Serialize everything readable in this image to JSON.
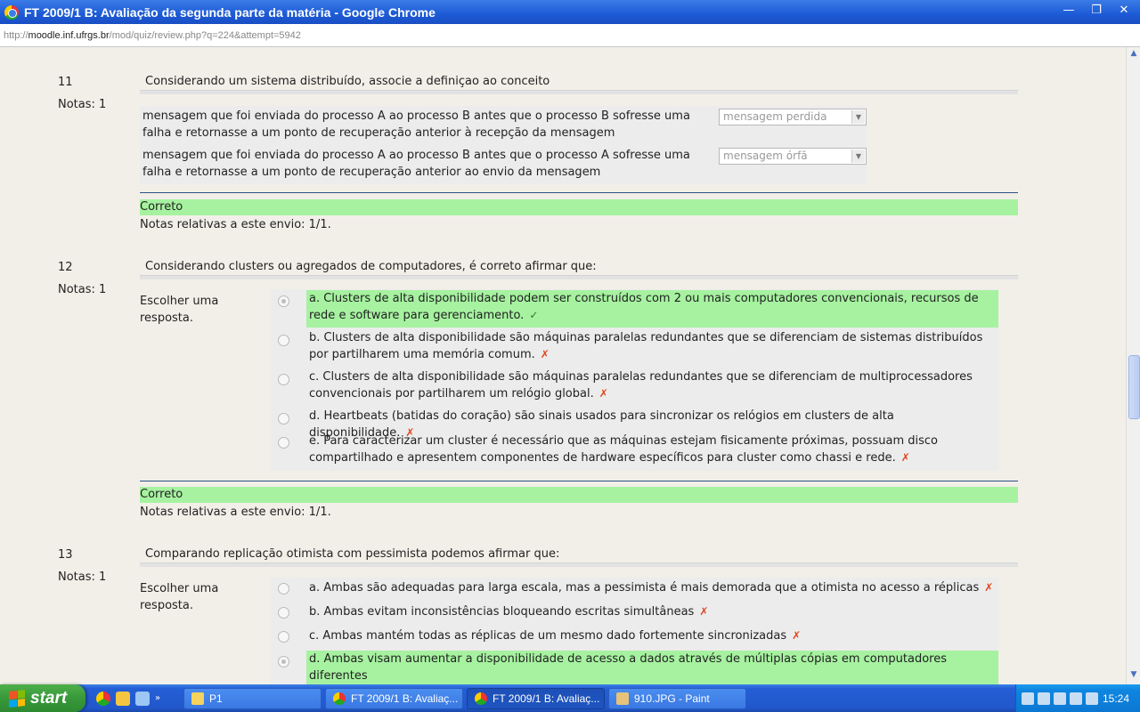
{
  "window": {
    "title": "FT 2009/1 B: Avaliação da segunda parte da matéria - Google Chrome",
    "buttons": {
      "minimize": "—",
      "restore": "❐",
      "close": "✕"
    }
  },
  "address": {
    "prefix": "http://",
    "host": "moodle.inf.ufrgs.br",
    "path": "/mod/quiz/review.php?q=224&attempt=5942"
  },
  "colors": {
    "correct_bg": "#a6f2a0",
    "wrong_mark": "#e0431c",
    "titlebar": "#1c5ad6"
  },
  "q11": {
    "number": "11",
    "grade": "Notas: 1",
    "text": "Considerando um sistema distribuído, associe a definiçao ao conceito",
    "rows": [
      {
        "text": "mensagem que foi enviada do processo A ao processo B antes que o processo B sofresse uma falha e retornasse a um ponto de recuperação anterior à recepção da mensagem",
        "selected": "mensagem perdida"
      },
      {
        "text": "mensagem que foi enviada do processo A ao processo B antes que o processo A sofresse uma falha e retornasse a um ponto de recuperação anterior ao envio da mensagem",
        "selected": "mensagem órfã"
      }
    ],
    "result": "Correto",
    "notes": "Notas relativas a este envio: 1/1."
  },
  "q12": {
    "number": "12",
    "grade": "Notas: 1",
    "text": "Considerando clusters ou agregados de computadores, é correto afirmar que:",
    "choose": "Escolher uma resposta.",
    "options": [
      {
        "text": "a. Clusters de alta disponibilidade podem ser construídos com 2 ou mais computadores convencionais, recursos de rede e software para gerenciamento.",
        "mark": "✓"
      },
      {
        "text": "b. Clusters de alta disponibilidade são máquinas paralelas redundantes que se diferenciam de sistemas distribuídos por partilharem uma memória comum.",
        "mark": "✗"
      },
      {
        "text": "c. Clusters de alta disponibilidade são máquinas paralelas redundantes que se diferenciam de multiprocessadores convencionais por partilharem um relógio global.",
        "mark": "✗"
      },
      {
        "text": "d. Heartbeats (batidas do coração) são sinais usados para sincronizar os relógios em clusters de alta disponibilidade.",
        "mark": "✗"
      },
      {
        "text": "e. Para caracterizar um cluster é necessário que as máquinas estejam fisicamente próximas, possuam disco compartilhado e apresentem componentes de hardware específicos para cluster como chassi e rede.",
        "mark": "✗"
      }
    ],
    "result": "Correto",
    "notes": "Notas relativas a este envio: 1/1."
  },
  "q13": {
    "number": "13",
    "grade": "Notas: 1",
    "text": "Comparando replicação otimista com pessimista podemos afirmar que:",
    "choose": "Escolher uma resposta.",
    "options": [
      {
        "text": "a. Ambas são adequadas para larga escala, mas a pessimista é mais demorada que a otimista no acesso a réplicas",
        "mark": "✗"
      },
      {
        "text": "b. Ambas evitam inconsistências bloqueando escritas simultâneas",
        "mark": "✗"
      },
      {
        "text": "c. Ambas mantém todas as réplicas de um mesmo dado fortemente sincronizadas",
        "mark": "✗"
      },
      {
        "text": "d. Ambas visam aumentar a disponibilidade de acesso a dados através de múltiplas cópias em computadores diferentes",
        "mark": "✓"
      }
    ]
  },
  "taskbar": {
    "start": "start",
    "more": "»",
    "tasks": [
      "P1",
      "FT 2009/1 B: Avaliaç...",
      "FT 2009/1 B: Avaliaç...",
      "910.JPG - Paint"
    ],
    "clock": "15:24"
  }
}
